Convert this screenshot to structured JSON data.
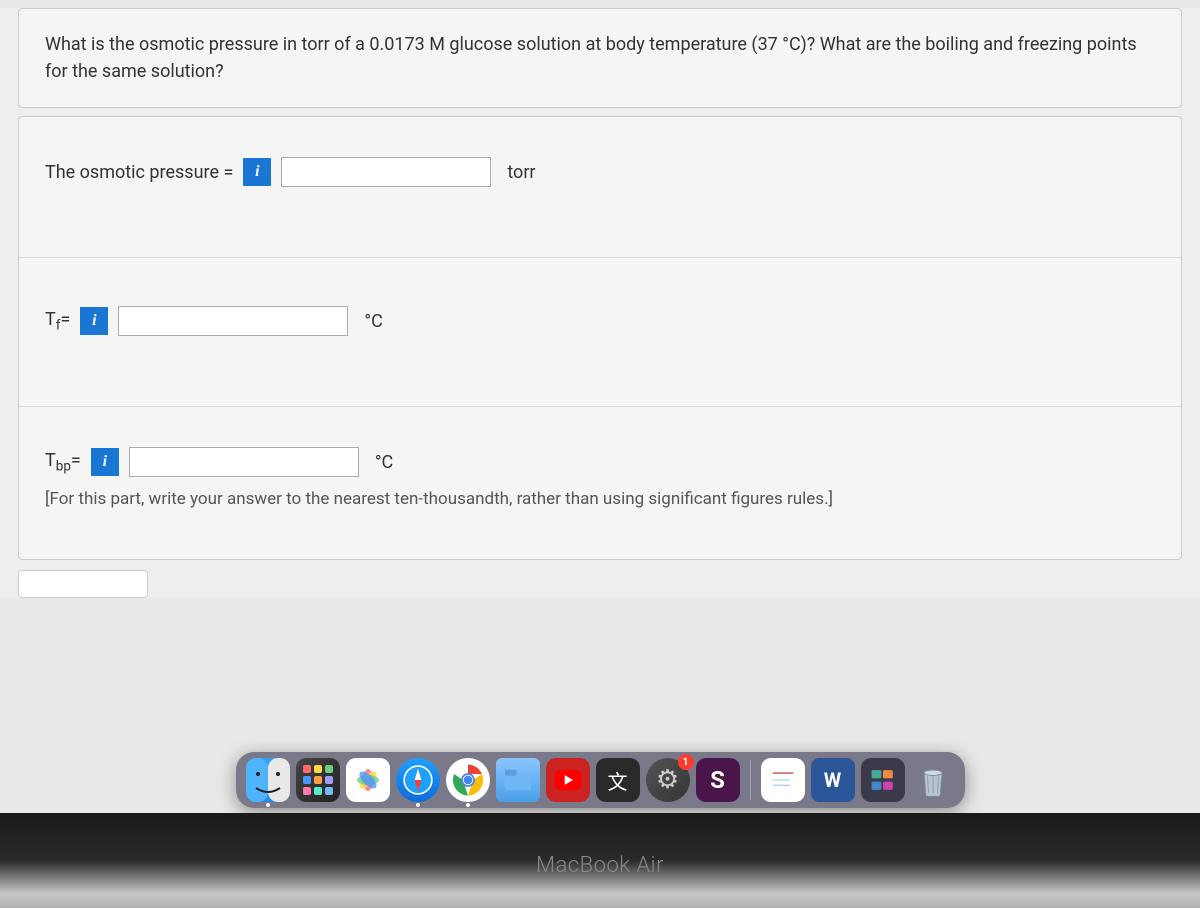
{
  "question": "What is the osmotic pressure in torr of a 0.0173 M glucose solution at body temperature (37 °C)? What are the boiling and freezing points for the same solution?",
  "answers": {
    "osmotic": {
      "label": "The osmotic pressure =",
      "unit": "torr",
      "value": ""
    },
    "tf": {
      "label_prefix": "T",
      "label_sub": "f",
      "label_suffix": "=",
      "unit": "°C",
      "value": ""
    },
    "tbp": {
      "label_prefix": "T",
      "label_sub": "bp",
      "label_suffix": "=",
      "unit": "°C",
      "value": "",
      "hint": "[For this part, write your answer to the nearest ten-thousandth, rather than using significant figures rules.]"
    }
  },
  "info_icon_label": "i",
  "dock": {
    "badge_count": "1"
  },
  "device": "MacBook Air"
}
